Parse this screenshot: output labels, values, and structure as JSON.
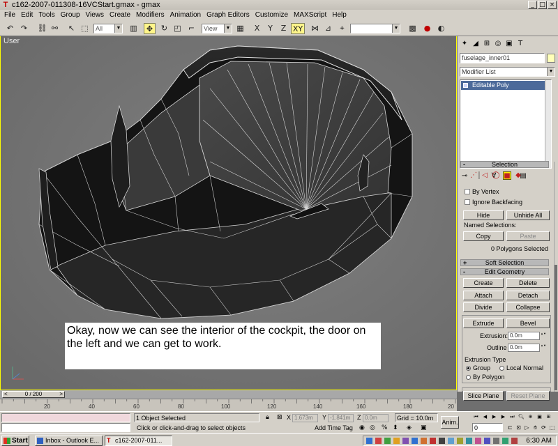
{
  "window": {
    "title": "c162-2007-011308-16VCStart.gmax - gmax",
    "controls": [
      "_",
      "□",
      "×"
    ]
  },
  "menu": [
    "File",
    "Edit",
    "Tools",
    "Group",
    "Views",
    "Create",
    "Modifiers",
    "Animation",
    "Graph Editors",
    "Customize",
    "MAXScript",
    "Help"
  ],
  "toolbar": {
    "selection_filter": "All",
    "ref_coord": "View",
    "named_selection": ""
  },
  "viewport": {
    "label": "User",
    "caption": "Okay, now we can see the interior of the cockpit, the door on the left and we can get to work."
  },
  "command_panel": {
    "object_name": "fuselage_inner01",
    "modifier_list": "Modifier List",
    "stack_item": "Editable Poly",
    "selection": {
      "title": "Selection",
      "by_vertex": "By Vertex",
      "ignore_backfacing": "Ignore Backfacing",
      "hide": "Hide",
      "unhide_all": "Unhide All",
      "named_selections": "Named Selections:",
      "copy": "Copy",
      "paste": "Paste",
      "status": "0 Polygons Selected"
    },
    "soft_selection": {
      "title": "Soft Selection"
    },
    "edit_geometry": {
      "title": "Edit Geometry",
      "create": "Create",
      "delete": "Delete",
      "attach": "Attach",
      "detach": "Detach",
      "divide": "Divide",
      "collapse": "Collapse",
      "extrude": "Extrude",
      "bevel": "Bevel",
      "extrusion_label": "Extrusion:",
      "extrusion_value": "0.0m",
      "outline_label": "Outline",
      "outline_value": "0.0m",
      "extrusion_type": "Extrusion Type",
      "group": "Group",
      "local_normal": "Local Normal",
      "by_polygon": "By Polygon",
      "slice_plane": "Slice Plane",
      "reset_plane": "Reset Plane"
    }
  },
  "timeline": {
    "slider": "0 / 200",
    "ticks": [
      "20",
      "40",
      "60",
      "80",
      "100",
      "120",
      "140",
      "160",
      "180",
      "20"
    ]
  },
  "status": {
    "selected": "1 Object Selected",
    "prompt": "Click or click-and-drag to select objects",
    "x_label": "X",
    "x_value": "1.673m",
    "y_label": "Y",
    "y_value": "-1.841m",
    "z_label": "Z",
    "z_value": "0.0m",
    "grid": "Grid = 10.0m",
    "add_time_tag": "Add Time Tag",
    "anim": "Anim.",
    "frame": "0"
  },
  "taskbar": {
    "start": "Start",
    "tasks": [
      "Inbox - Outlook E...",
      "c162-2007-011..."
    ],
    "clock": "6:30 AM"
  }
}
